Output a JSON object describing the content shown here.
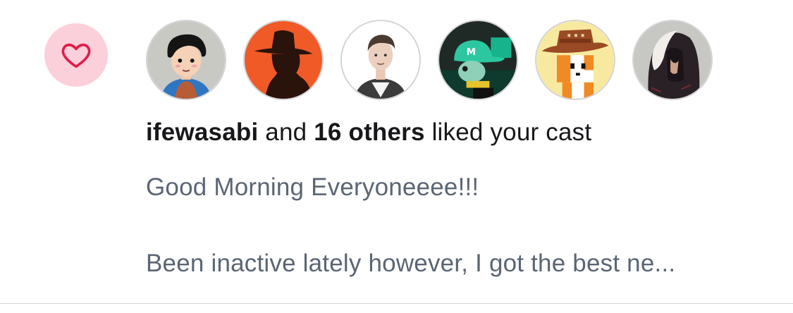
{
  "notification": {
    "type_icon": "heart-icon",
    "colors": {
      "badge_bg": "#fbd0da",
      "heart": "#e11d48",
      "text_primary": "#18181b",
      "text_secondary": "#5b6574"
    },
    "avatars": [
      {
        "name": "avatar-cartoon-person-icon"
      },
      {
        "name": "avatar-silhouette-hat-icon"
      },
      {
        "name": "avatar-young-man-photo"
      },
      {
        "name": "avatar-green-cap-character-icon"
      },
      {
        "name": "avatar-cowboy-cat-pixel-icon"
      },
      {
        "name": "avatar-hooded-figure-icon"
      }
    ],
    "summary": {
      "actor": "ifewasabi",
      "conjunction": " and ",
      "others": "16 others",
      "action": " liked your cast"
    },
    "cast_preview": {
      "line1": "Good Morning Everyoneeee!!!",
      "line2": "Been inactive lately however, I got the best ne..."
    }
  }
}
